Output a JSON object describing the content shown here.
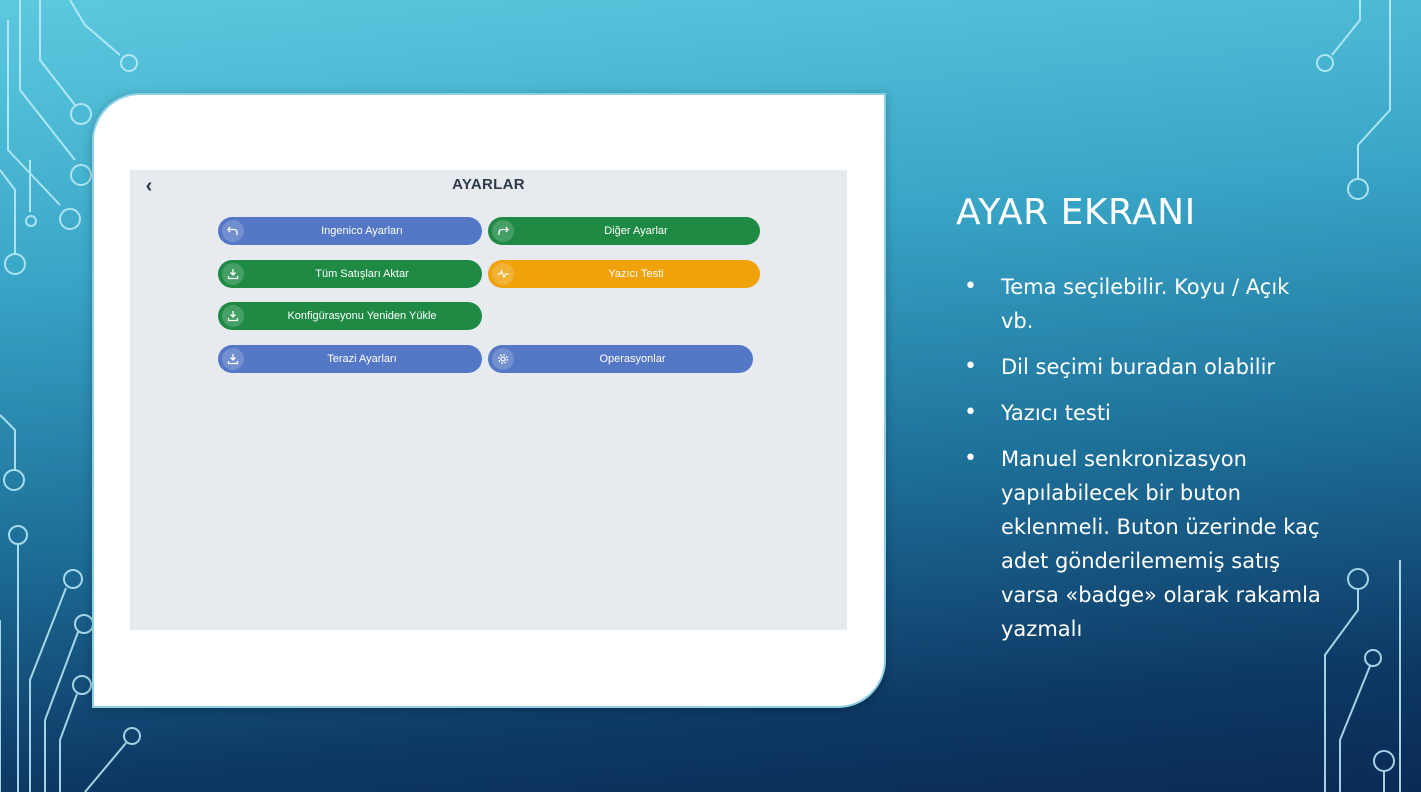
{
  "slide": {
    "title": "AYAR EKRANI",
    "bullets": [
      "Tema seçilebilir. Koyu / Açık vb.",
      "Dil seçimi buradan olabilir",
      "Yazıcı testi",
      "Manuel senkronizasyon yapılabilecek bir buton eklenmeli. Buton üzerinde kaç adet gönderilememiş satış varsa «badge» olarak rakamla yazmalı"
    ]
  },
  "app": {
    "back_icon": "chevron-left",
    "title": "AYARLAR",
    "buttons": [
      {
        "label": "Ingenico Ayarları",
        "icon": "undo-arrow-icon",
        "color": "#5478c6"
      },
      {
        "label": "Diğer Ayarlar",
        "icon": "redo-arrow-icon",
        "color": "#1e8a43"
      },
      {
        "label": "Tüm Satışları Aktar",
        "icon": "download-icon",
        "color": "#1e8a43"
      },
      {
        "label": "Yazıcı Testi",
        "icon": "pulse-icon",
        "color": "#f0a20a"
      },
      {
        "label": "Konfigürasyonu Yeniden Yükle",
        "icon": "download-icon",
        "color": "#1e8a43"
      },
      {
        "label": "Terazi Ayarları",
        "icon": "download-icon",
        "color": "#5478c6"
      },
      {
        "label": "Operasyonlar",
        "icon": "gear-icon",
        "color": "#5478c6"
      }
    ]
  }
}
